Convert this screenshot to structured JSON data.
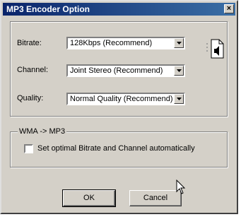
{
  "window": {
    "title": "MP3 Encoder Option",
    "close_glyph": "×"
  },
  "settings": {
    "bitrate": {
      "label": "Bitrate:",
      "value": "128Kbps (Recommend)"
    },
    "channel": {
      "label": "Channel:",
      "value": "Joint Stereo (Recommend)"
    },
    "quality": {
      "label": "Quality:",
      "value": "Normal Quality (Recommend)"
    }
  },
  "wma_group": {
    "title": "WMA -> MP3",
    "checkbox_label": "Set optimal Bitrate and Channel automatically",
    "checked": false
  },
  "buttons": {
    "ok": "OK",
    "cancel": "Cancel"
  },
  "icons": {
    "settings_file": "audio-file-icon",
    "pointer": "mouse-cursor-icon"
  }
}
